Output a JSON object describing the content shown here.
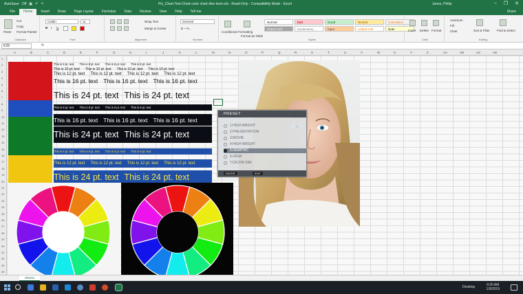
{
  "titlebar": {
    "autosave": "AutoSave",
    "autosave_state": "Off",
    "title": "Pix_Chart-Text-Chart-color chart dive keen.xls - Read-Only - Compatibility Mode - Excel",
    "user": "Jones, Philip"
  },
  "tabs": [
    "File",
    "Home",
    "Insert",
    "Draw",
    "Page Layout",
    "Formulas",
    "Data",
    "Review",
    "View",
    "Help",
    "Tell me"
  ],
  "active_tab": "Home",
  "share_label": "Share",
  "ribbon": {
    "clipboard": {
      "paste": "Paste",
      "cut": "Cut",
      "copy": "Copy",
      "format_painter": "Format Painter",
      "label": "Clipboard"
    },
    "font": {
      "name": "Calibri",
      "size": "11",
      "label": "Font"
    },
    "alignment": {
      "wrap": "Wrap Text",
      "merge": "Merge & Center",
      "label": "Alignment"
    },
    "number": {
      "format": "General",
      "label": "Number"
    },
    "styles": {
      "conditional": "Conditional Formatting",
      "format_as_table": "Format as Table",
      "cells": [
        {
          "label": "Normal",
          "bg": "#ffffff",
          "fg": "#222222"
        },
        {
          "label": "Bad",
          "bg": "#ffc7ce",
          "fg": "#9c0006"
        },
        {
          "label": "Good",
          "bg": "#c6efce",
          "fg": "#006100"
        },
        {
          "label": "Neutral",
          "bg": "#ffeb9c",
          "fg": "#9c5700"
        },
        {
          "label": "Calculation",
          "bg": "#f2f2f2",
          "fg": "#fa7d00"
        },
        {
          "label": "Check Cell",
          "bg": "#a5a5a5",
          "fg": "#ffffff"
        },
        {
          "label": "Explanatory ...",
          "bg": "#ffffff",
          "fg": "#7f7f7f"
        },
        {
          "label": "Input",
          "bg": "#ffcc99",
          "fg": "#3f3f76"
        },
        {
          "label": "Linked Cell",
          "bg": "#ffffff",
          "fg": "#fa7d00"
        },
        {
          "label": "Note",
          "bg": "#ffffcc",
          "fg": "#222222"
        }
      ],
      "label": "Styles"
    },
    "cells": {
      "insert": "Insert",
      "delete": "Delete",
      "format": "Format",
      "label": "Cells"
    },
    "editing": {
      "autosum": "AutoSum",
      "fill": "Fill",
      "clear": "Clear",
      "sort": "Sort & Filter",
      "find": "Find & Select",
      "label": "Editing"
    }
  },
  "formula_bar": {
    "name_box": "K28",
    "fx": "fx"
  },
  "columns": [
    "A",
    "B",
    "C",
    "D",
    "E",
    "F",
    "G",
    "H",
    "I",
    "J",
    "K",
    "L",
    "M",
    "N",
    "O",
    "P",
    "Q",
    "R",
    "S",
    "T",
    "U",
    "V",
    "W",
    "X",
    "Y",
    "Z",
    "AA",
    "AB",
    "AC",
    "AD"
  ],
  "rows": [
    "1",
    "2",
    "3",
    "4",
    "5",
    "6",
    "7",
    "8",
    "9",
    "10",
    "11",
    "12",
    "13",
    "14",
    "15",
    "16",
    "17",
    "18",
    "19",
    "20",
    "21",
    "22",
    "23",
    "24",
    "25",
    "26",
    "27",
    "28",
    "29",
    "30",
    "31",
    "32",
    "33",
    "34",
    "35"
  ],
  "text_samples": {
    "row_8pt": "This is 8 pt. text",
    "row_10pt": "This is 10 pt. text",
    "row_12pt": "This is 12 pt. text",
    "row_16pt": "This is 16 pt. text",
    "row_24pt": "This is 24 pt. text"
  },
  "color_blocks": {
    "red": "#d3141b",
    "blue": "#1f4fbf",
    "green": "#0e7a28",
    "yellow": "#f0c610",
    "dark_bar": "#0b0d14",
    "blue_bar": "#1f4fa8"
  },
  "osd_menu": {
    "title": "PRESET",
    "items": [
      {
        "label": "1:HIGH-BRIGHT",
        "selected": false
      },
      {
        "label": "2:PRESENTATION",
        "selected": false
      },
      {
        "label": "3:MOVIE",
        "selected": false
      },
      {
        "label": "4:HIGH-BRIGHT",
        "selected": false
      },
      {
        "label": "5:GRAPHIC",
        "selected": true
      },
      {
        "label": "6:sRGB",
        "selected": false
      },
      {
        "label": "7:DICOM SIM.",
        "selected": false
      }
    ],
    "footer": {
      "enter": "ENTER",
      "exit": "EXIT"
    }
  },
  "sheet_tab": "Sheet1",
  "taskbar": {
    "desktop_label": "Desktop",
    "time": "9:20 AM",
    "date": "1/9/2019"
  }
}
